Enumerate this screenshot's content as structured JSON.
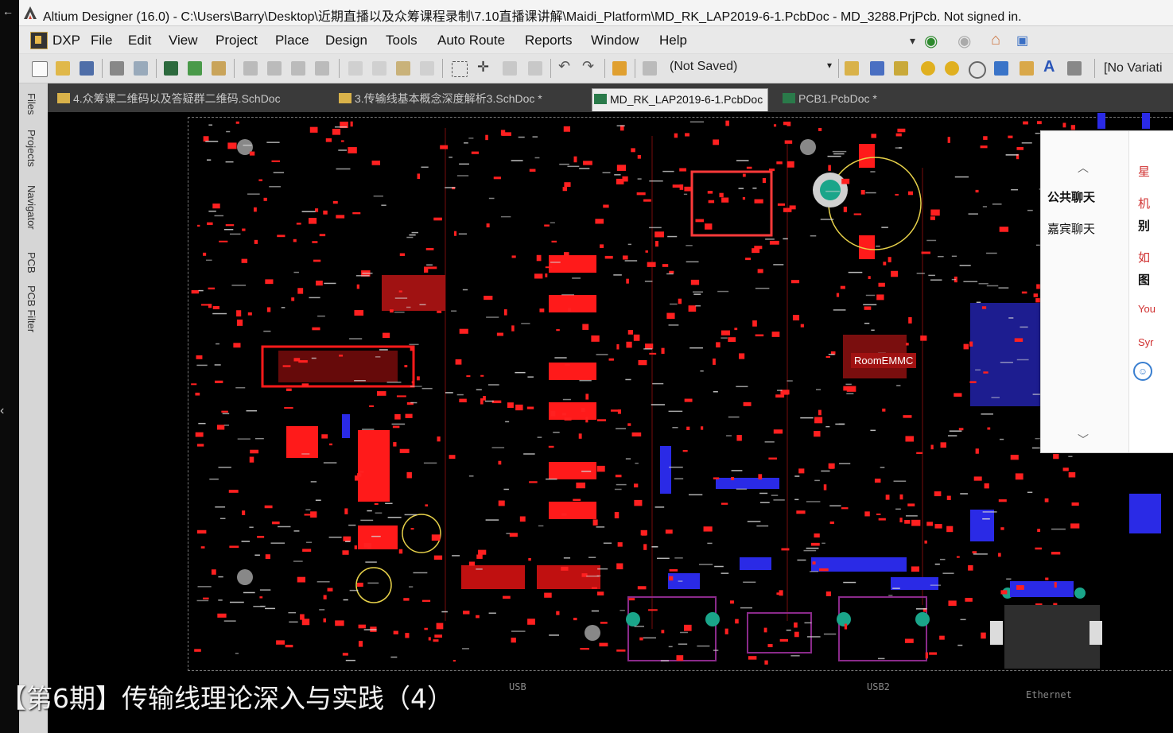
{
  "window": {
    "title": "Altium Designer (16.0) - C:\\Users\\Barry\\Desktop\\近期直播以及众筹课程录制\\7.10直播课讲解\\Maidi_Platform\\MD_RK_LAP2019-6-1.PcbDoc - MD_3288.PrjPcb. Not signed in."
  },
  "menu": {
    "items": [
      "DXP",
      "File",
      "Edit",
      "View",
      "Project",
      "Place",
      "Design",
      "Tools",
      "Auto Route",
      "Reports",
      "Window",
      "Help"
    ]
  },
  "toolbar": {
    "saved_state": "(Not Saved)",
    "variant": "[No Variati"
  },
  "side_panels": [
    "Files",
    "Projects",
    "Navigator",
    "PCB",
    "PCB Filter"
  ],
  "tabs": [
    {
      "label": "4.众筹课二维码以及答疑群二维码.SchDoc",
      "active": false
    },
    {
      "label": "3.传输线基本概念深度解析3.SchDoc *",
      "active": false
    },
    {
      "label": "MD_RK_LAP2019-6-1.PcbDoc",
      "active": true
    },
    {
      "label": "PCB1.PcbDoc *",
      "active": false
    }
  ],
  "pcb": {
    "room_label": "RoomEMMC",
    "bottom_labels": [
      "USB",
      "USB2",
      "Ethernet"
    ]
  },
  "chat": {
    "tabs": [
      "公共聊天",
      "嘉宾聊天"
    ],
    "right_fragments": [
      "星",
      "机",
      "别",
      "如",
      "图",
      "You",
      "Syr"
    ]
  },
  "caption": "【第6期】传输线理论深入与实践（4）",
  "colors": {
    "top_layer": "#ff1a1a",
    "bottom_layer": "#2a2ae6",
    "silkscreen": "#e8e866",
    "pad_teal": "#1aa58a"
  }
}
